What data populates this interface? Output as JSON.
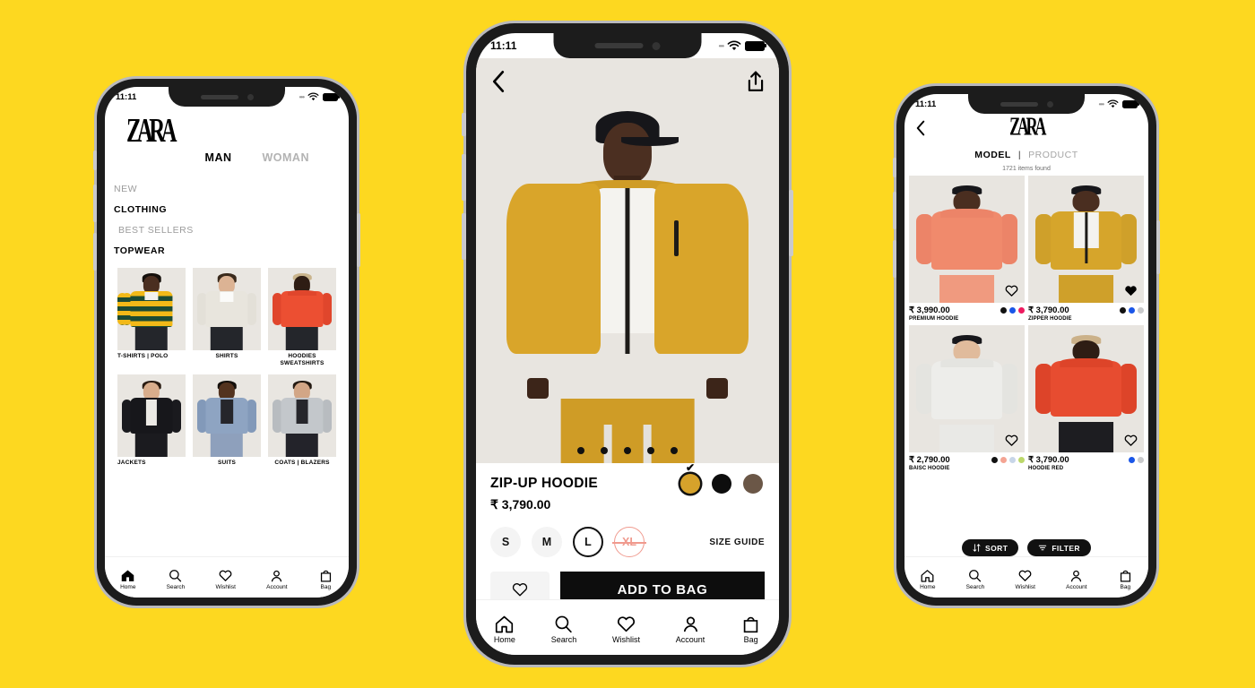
{
  "background_color": "#FDD820",
  "brand": "ZARA",
  "status_bar": {
    "time": "11:11",
    "wifi": "wifi-icon",
    "battery": "battery-icon"
  },
  "tabbar": [
    {
      "label": "Home",
      "icon": "home-icon"
    },
    {
      "label": "Search",
      "icon": "search-icon"
    },
    {
      "label": "Wishlist",
      "icon": "heart-icon"
    },
    {
      "label": "Account",
      "icon": "person-icon"
    },
    {
      "label": "Bag",
      "icon": "bag-icon"
    }
  ],
  "left_phone": {
    "logo": "ZARA",
    "gender_tabs": [
      {
        "label": "MAN",
        "active": true
      },
      {
        "label": "WOMAN",
        "active": false
      }
    ],
    "menu": [
      {
        "label": "NEW",
        "style": "muted"
      },
      {
        "label": "CLOTHING",
        "style": "bold"
      },
      {
        "label": "BEST SELLERS",
        "style": "muted-indent"
      },
      {
        "label": "TOPWEAR",
        "style": "bold"
      }
    ],
    "categories": [
      {
        "label": "T-SHIRTS | POLO"
      },
      {
        "label": "SHIRTS"
      },
      {
        "label": "HOODIES\nSWEATSHIRTS"
      },
      {
        "label": "JACKETS"
      },
      {
        "label": "SUITS"
      },
      {
        "label": "COATS | BLAZERS"
      }
    ]
  },
  "center_phone": {
    "back_icon": "chevron-left-icon",
    "share_icon": "share-icon",
    "carousel_dots": 5,
    "carousel_active_index": 2,
    "product": {
      "title": "ZIP-UP HOODIE",
      "price": "₹ 3,790.00",
      "colors": [
        {
          "name": "mustard",
          "hex": "#D6A22B",
          "selected": true
        },
        {
          "name": "black",
          "hex": "#0D0D0D",
          "selected": false
        },
        {
          "name": "brown",
          "hex": "#6B5747",
          "selected": false
        }
      ],
      "sizes": [
        {
          "label": "S",
          "state": "available"
        },
        {
          "label": "M",
          "state": "available"
        },
        {
          "label": "L",
          "state": "selected"
        },
        {
          "label": "XL",
          "state": "unavailable"
        }
      ],
      "size_guide_label": "SIZE GUIDE",
      "wishlist_icon": "heart-icon",
      "add_to_bag_label": "ADD TO BAG"
    }
  },
  "right_phone": {
    "back_icon": "chevron-left-icon",
    "logo": "ZARA",
    "view_tabs": [
      {
        "label": "MODEL",
        "active": true
      },
      {
        "label": "|",
        "separator": true
      },
      {
        "label": "PRODUCT",
        "active": false
      }
    ],
    "items_found": "1721 items found",
    "products": [
      {
        "price": "₹ 3,990.00",
        "name": "PREMIUM HOODIE",
        "wishlisted": false,
        "garment_color": "#F08A6C",
        "swatches": [
          "#111111",
          "#1A56E8",
          "#EE1A5F"
        ]
      },
      {
        "price": "₹ 3,790.00",
        "name": "ZIPPER HOODIE",
        "wishlisted": true,
        "garment_color": "#D6A52B",
        "swatches": [
          "#111111",
          "#1A56E8",
          "#C9CACC"
        ]
      },
      {
        "price": "₹ 2,790.00",
        "name": "BAISC HOODIE",
        "wishlisted": false,
        "garment_color": "#EDEDEA",
        "swatches": [
          "#111111",
          "#F4A493",
          "#C8D6E8",
          "#BCD86A"
        ]
      },
      {
        "price": "₹ 3,790.00",
        "name": "HOODIE RED",
        "wishlisted": false,
        "garment_color": "#E74C30",
        "swatches": [
          "#1A56E8",
          "#C9CACC"
        ]
      }
    ],
    "sort_label": "SORT",
    "filter_label": "FILTER",
    "sort_icon": "sort-arrows-icon",
    "filter_icon": "filter-icon"
  }
}
